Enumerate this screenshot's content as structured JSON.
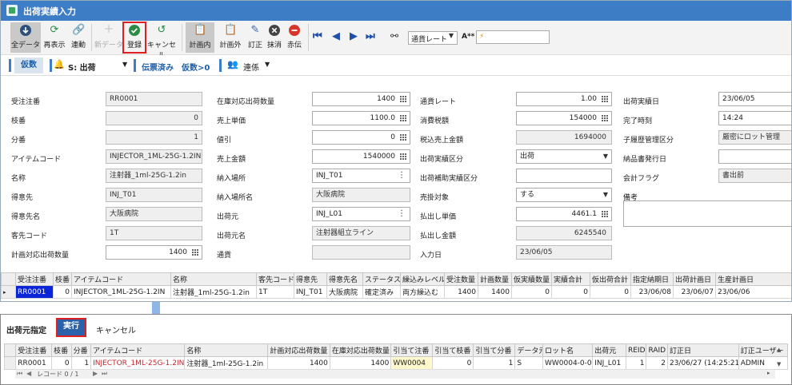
{
  "window": {
    "title": "出荷実績入力"
  },
  "toolbar": {
    "all_data": "全データ",
    "redisplay": "再表示",
    "link": "連動",
    "new_data": "新データ",
    "register": "登録",
    "cancel": "キャンセル",
    "plan_in": "計画内",
    "plan_out": "計画外",
    "correct": "訂正",
    "erase": "抹消",
    "red_slip": "赤伝",
    "currency_rate": "通貨レート",
    "font_size": "A**"
  },
  "toolbar2": {
    "kari": "仮数",
    "shipment_type": "S: 出荷",
    "slip_status": "伝票済み",
    "kari_count": "仮数>0",
    "related": "連係"
  },
  "form": {
    "col1": [
      {
        "label": "受注注番",
        "value": "RR0001"
      },
      {
        "label": "枝番",
        "value": "0"
      },
      {
        "label": "分番",
        "value": "1"
      },
      {
        "label": "アイテムコード",
        "value": "INJECTOR_1ML-25G-1.2IN"
      },
      {
        "label": "名称",
        "value": "注射器_1ml-25G-1.2in"
      },
      {
        "label": "得意先",
        "value": "INJ_T01"
      },
      {
        "label": "得意先名",
        "value": "大阪病院"
      },
      {
        "label": "客先コード",
        "value": "1T"
      },
      {
        "label": "計画対応出荷数量",
        "value": "1400"
      }
    ],
    "col2": [
      {
        "label": "在庫対応出荷数量",
        "value": "1400"
      },
      {
        "label": "売上単価",
        "value": "1100.0"
      },
      {
        "label": "値引",
        "value": "0"
      },
      {
        "label": "売上金額",
        "value": "1540000"
      },
      {
        "label": "納入場所",
        "value": "INJ_T01"
      },
      {
        "label": "納入場所名",
        "value": "大阪病院"
      },
      {
        "label": "出荷元",
        "value": "INJ_L01"
      },
      {
        "label": "出荷元名",
        "value": "注射器組立ライン"
      },
      {
        "label": "通貨",
        "value": ""
      }
    ],
    "col3": [
      {
        "label": "通貨レート",
        "value": "1.00"
      },
      {
        "label": "消費税額",
        "value": "154000"
      },
      {
        "label": "税込売上金額",
        "value": "1694000"
      },
      {
        "label": "出荷実績区分",
        "value": "出荷"
      },
      {
        "label": "出荷補助実績区分",
        "value": ""
      },
      {
        "label": "売掛対象",
        "value": "する"
      },
      {
        "label": "払出し単価",
        "value": "4461.1"
      },
      {
        "label": "払出し金額",
        "value": "6245540"
      },
      {
        "label": "入力日",
        "value": "23/06/05"
      }
    ],
    "col4": [
      {
        "label": "出荷実績日",
        "value": "23/06/05"
      },
      {
        "label": "完了時刻",
        "value": "14:24"
      },
      {
        "label": "子履歴管理区分",
        "value": "厳密にロット管理"
      },
      {
        "label": "納品書発行日",
        "value": ""
      },
      {
        "label": "会計フラグ",
        "value": "書出前"
      },
      {
        "label": "備考",
        "value": ""
      }
    ]
  },
  "grid1": {
    "headers": [
      "受注注番",
      "枝番",
      "アイテムコード",
      "名称",
      "客先コード",
      "得意先",
      "得意先名",
      "ステータス",
      "繰込みレベル",
      "受注数量",
      "計画数量",
      "仮実績数量",
      "実績合計",
      "仮出荷合計",
      "指定納期日",
      "出荷計画日",
      "生産計画日"
    ],
    "row": [
      "RR0001",
      "0",
      "INJECTOR_1ML-25G-1.2IN",
      "注射器_1ml-25G-1.2in",
      "1T",
      "INJ_T01",
      "大阪病院",
      "確定済み",
      "両方繰込む",
      "1400",
      "1400",
      "0",
      "0",
      "0",
      "23/06/08",
      "23/06/07",
      "23/06/06"
    ]
  },
  "panel2": {
    "title": "出荷元指定",
    "execute": "実行",
    "cancel": "キャンセル",
    "headers": [
      "受注注番",
      "枝番",
      "分番",
      "アイテムコード",
      "名称",
      "計画対応出荷数量",
      "在庫対応出荷数量",
      "引当て注番",
      "引当て枝番",
      "引当て分番",
      "データ元",
      "ロット名",
      "出荷元",
      "REID",
      "RAID",
      "訂正日",
      "訂正ユーザー"
    ],
    "row": [
      "RR0001",
      "0",
      "1",
      "INJECTOR_1ML-25G-1.2IN",
      "注射器_1ml-25G-1.2in",
      "1400",
      "1400",
      "WW0004",
      "0",
      "1",
      "S",
      "WW0004-0-0",
      "INJ_L01",
      "1",
      "2",
      "23/06/27 (14:25:21)",
      "ADMIN"
    ],
    "record_nav": "レコード 0 / 1"
  }
}
